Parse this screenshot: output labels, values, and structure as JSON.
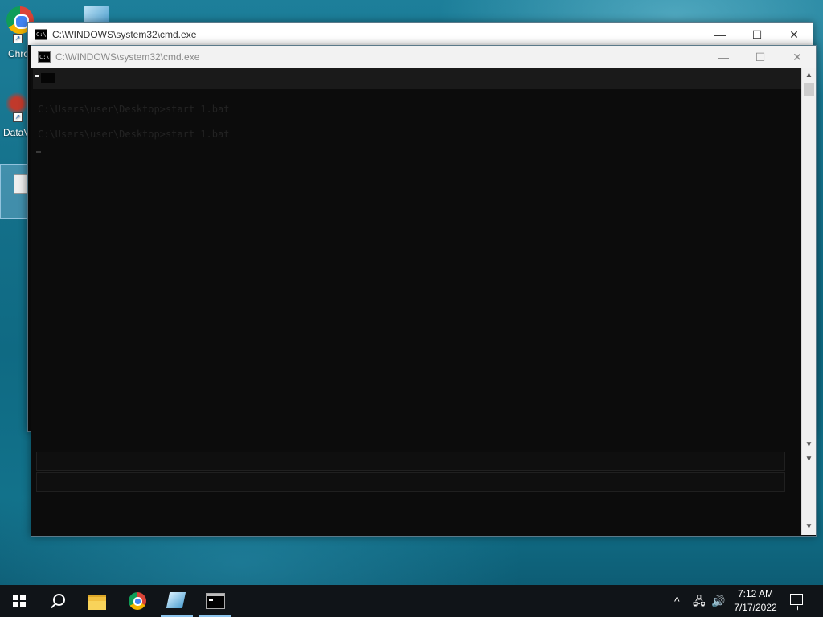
{
  "desktop": {
    "icons": [
      {
        "label": "Chro"
      },
      {
        "label": "DataV"
      }
    ]
  },
  "windows": {
    "back": {
      "title": "C:\\WINDOWS\\system32\\cmd.exe",
      "icon": "cmd-icon",
      "controls": {
        "minimize": "—",
        "maximize": "☐",
        "close": "✕"
      }
    },
    "front": {
      "title": "C:\\WINDOWS\\system32\\cmd.exe",
      "icon": "cmd-icon",
      "controls": {
        "minimize": "—",
        "maximize": "☐",
        "close": "✕"
      },
      "console_lines": [
        "C:\\Users\\user\\Desktop>start 1.bat",
        "C:\\Users\\user\\Desktop>start 1.bat"
      ]
    }
  },
  "taskbar": {
    "items": [
      "start-icon",
      "search-icon",
      "file-explorer-icon",
      "chrome-icon",
      "app-icon",
      "cmd-icon"
    ],
    "tray": {
      "chevron": "^",
      "network": "🖧",
      "volume": "🔊"
    },
    "time": "7:12 AM",
    "date": "7/17/2022"
  },
  "colors": {
    "console_bg": "#0c0c0c",
    "taskbar_bg": "#101418",
    "desktop_accent": "#1d7f9a"
  }
}
